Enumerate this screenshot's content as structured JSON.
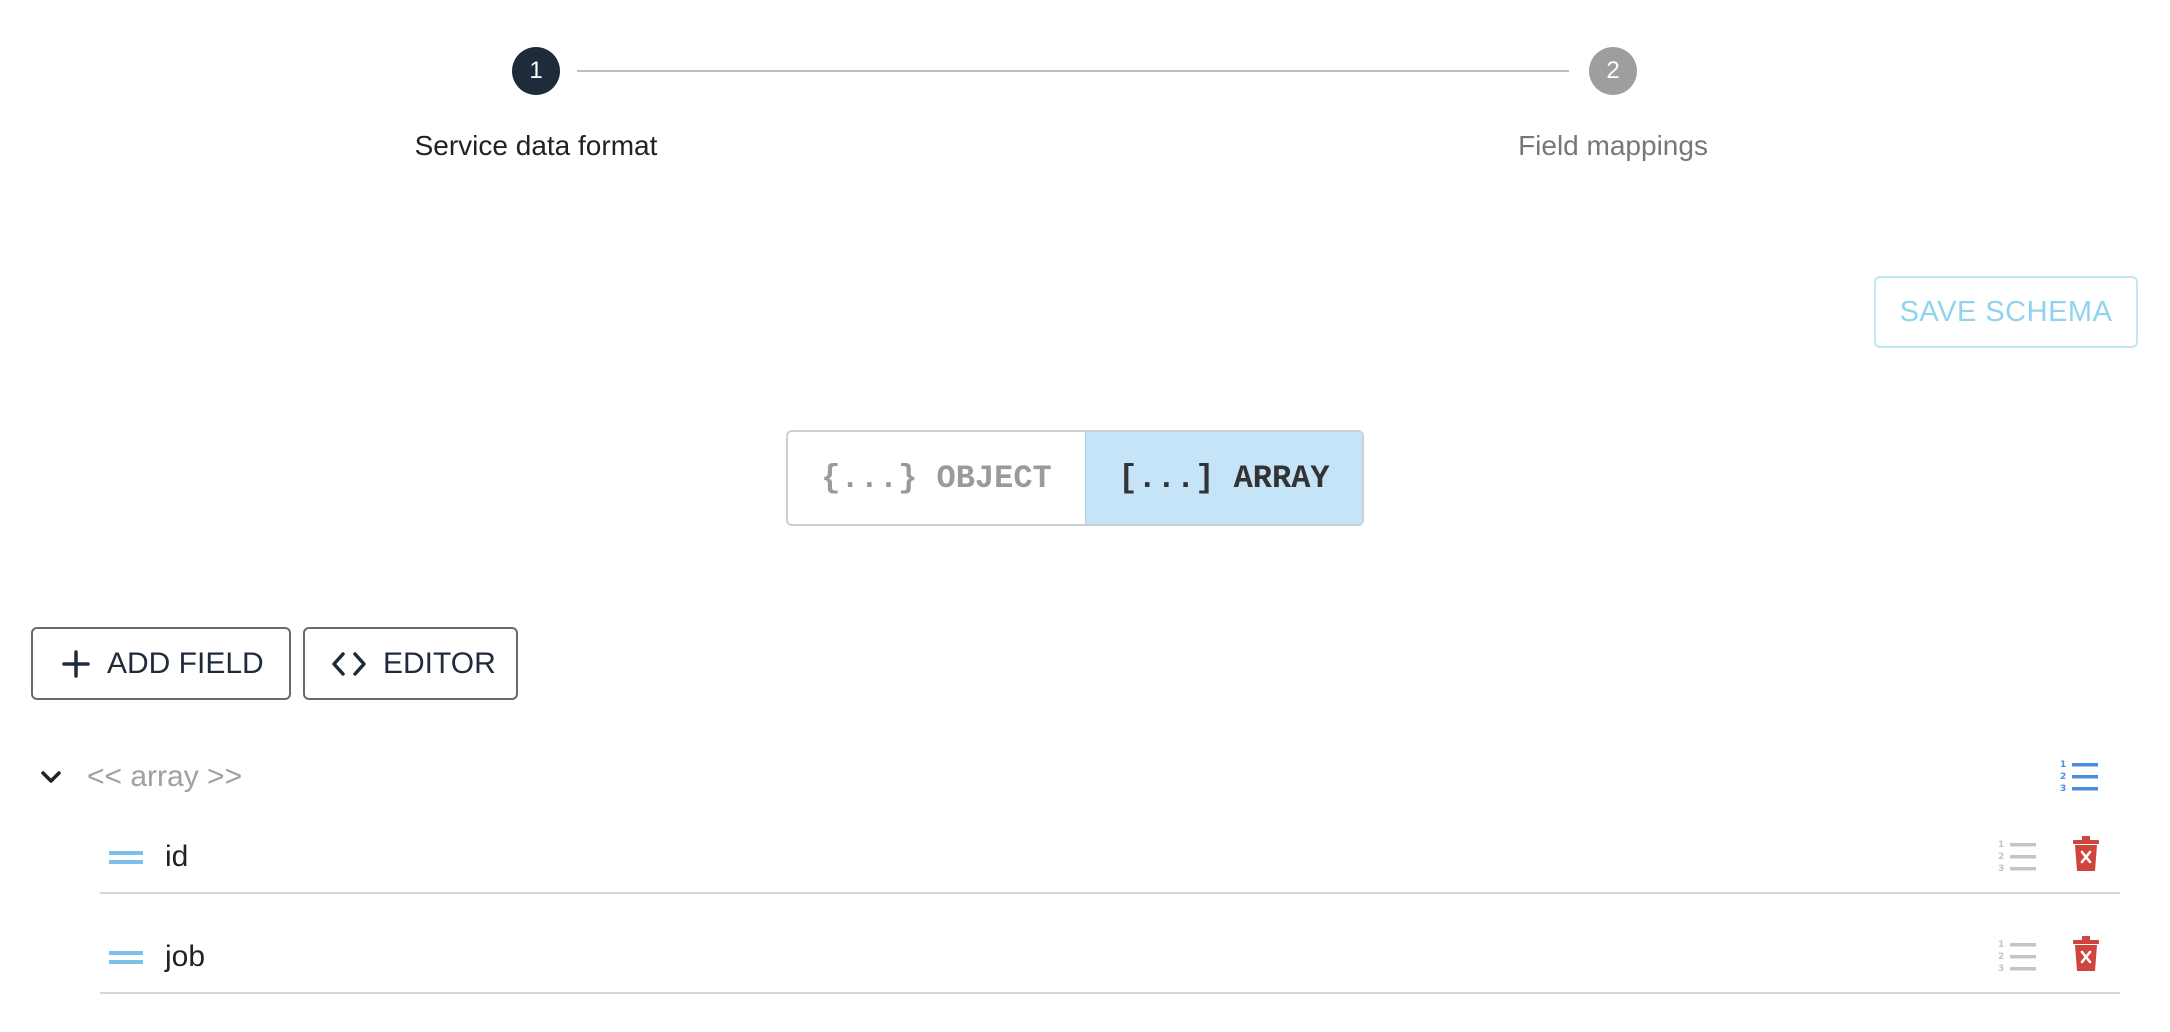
{
  "stepper": {
    "steps": [
      {
        "number": "1",
        "label": "Service data format"
      },
      {
        "number": "2",
        "label": "Field mappings"
      }
    ]
  },
  "toolbar": {
    "save_label": "SAVE SCHEMA",
    "add_field_label": "ADD FIELD",
    "editor_label": "EDITOR"
  },
  "format_toggle": {
    "object_label": "{...} OBJECT",
    "array_label": "[...] ARRAY",
    "selected": "array"
  },
  "tree": {
    "root_label": "<< array >>",
    "fields": [
      {
        "name": "id"
      },
      {
        "name": "job"
      }
    ]
  },
  "colors": {
    "active_step": "#1f2a3b",
    "inactive_step": "#9e9e9e",
    "accent_blue": "#4a8ee0",
    "selected_toggle": "#c5e4f7",
    "delete_red": "#d0443e"
  }
}
